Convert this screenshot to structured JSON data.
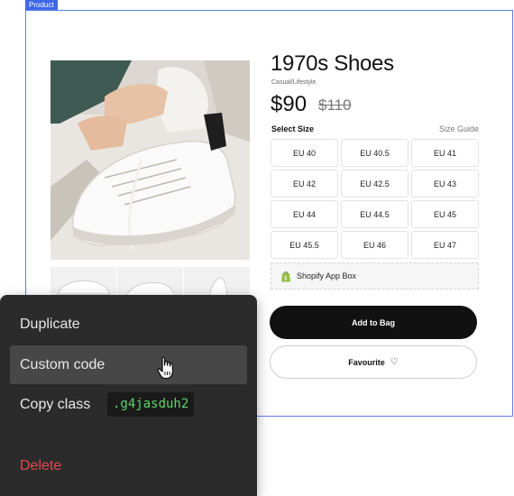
{
  "frame": {
    "tag": "Product"
  },
  "product": {
    "title": "1970s Shoes",
    "subtitle": "Casual/Lifestyle",
    "price": "$90",
    "old_price": "$110",
    "select_size_label": "Select Size",
    "size_guide_label": "Size Guide",
    "sizes": [
      "EU 40",
      "EU 40.5",
      "EU 41",
      "EU 42",
      "EU 42.5",
      "EU 43",
      "EU 44",
      "EU 44.5",
      "EU 45",
      "EU 45.5",
      "EU 46",
      "EU 47"
    ],
    "app_box_label": "Shopify App Box",
    "add_to_bag_label": "Add to Bag",
    "favourite_label": "Favourite",
    "favourite_icon": "heart-outline-icon"
  },
  "context_menu": {
    "duplicate_label": "Duplicate",
    "custom_code_label": "Custom code",
    "copy_class_label": "Copy class",
    "class_name": ".g4jasduh2",
    "delete_label": "Delete",
    "hovered_item": "Custom code",
    "colors": {
      "background": "#2b2b2b",
      "hover": "#474747",
      "class_text": "#5fd46a",
      "delete_text": "#e5484d"
    }
  },
  "colors": {
    "frame_border": "#5b7fe8",
    "frame_tag": "#3f67e6",
    "primary_button": "#111111",
    "shopify_green": "#95bf47"
  }
}
